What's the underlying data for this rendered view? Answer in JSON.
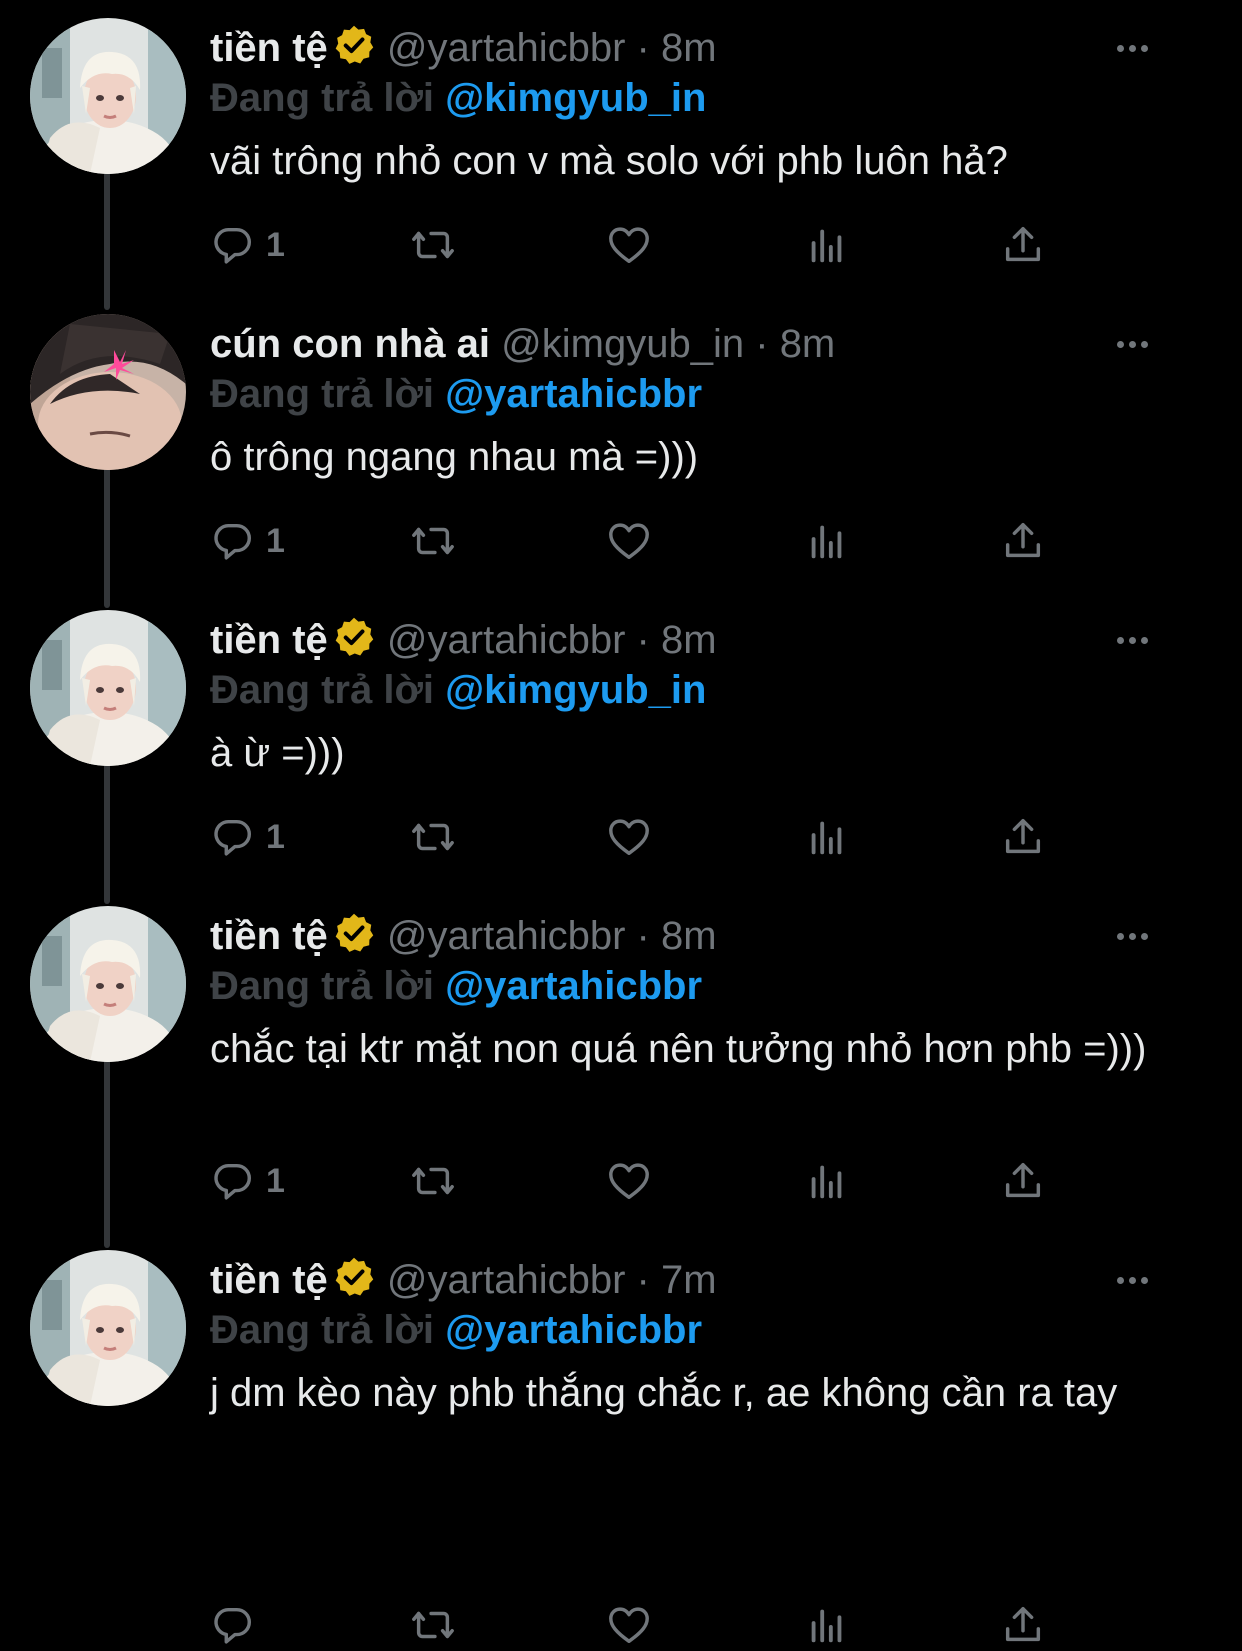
{
  "colors": {
    "background": "#000000",
    "text": "#e7e9ea",
    "muted": "#71767b",
    "link": "#1d9bf0",
    "verified_badge": "#e2b719",
    "thread_line": "#333639"
  },
  "tweets": [
    {
      "display_name": "tiền tệ",
      "verified": true,
      "handle": "@yartahicbbr",
      "separator": "·",
      "time": "8m",
      "reply_prefix": "Đang trả lời",
      "reply_target": "@kimgyub_in",
      "text": "vãi trông nhỏ con v mà solo với phb luôn hả?",
      "reply_count": "1",
      "avatar_icon": "avatar-blond-person"
    },
    {
      "display_name": "cún con nhà ai",
      "verified": false,
      "handle": "@kimgyub_in",
      "separator": "·",
      "time": "8m",
      "reply_prefix": "Đang trả lời",
      "reply_target": "@yartahicbbr",
      "text": "ô trông ngang nhau mà =)))",
      "reply_count": "1",
      "avatar_icon": "avatar-dark-hair-person"
    },
    {
      "display_name": "tiền tệ",
      "verified": true,
      "handle": "@yartahicbbr",
      "separator": "·",
      "time": "8m",
      "reply_prefix": "Đang trả lời",
      "reply_target": "@kimgyub_in",
      "text": "à ừ =)))",
      "reply_count": "1",
      "avatar_icon": "avatar-blond-person"
    },
    {
      "display_name": "tiền tệ",
      "verified": true,
      "handle": "@yartahicbbr",
      "separator": "·",
      "time": "8m",
      "reply_prefix": "Đang trả lời",
      "reply_target": "@yartahicbbr",
      "text": "chắc tại ktr mặt non quá nên tưởng nhỏ hơn phb =)))",
      "reply_count": "1",
      "avatar_icon": "avatar-blond-person"
    },
    {
      "display_name": "tiền tệ",
      "verified": true,
      "handle": "@yartahicbbr",
      "separator": "·",
      "time": "7m",
      "reply_prefix": "Đang trả lời",
      "reply_target": "@yartahicbbr",
      "text": "j dm kèo này phb thắng chắc r, ae không cần ra tay",
      "reply_count": "",
      "avatar_icon": "avatar-blond-person"
    }
  ]
}
